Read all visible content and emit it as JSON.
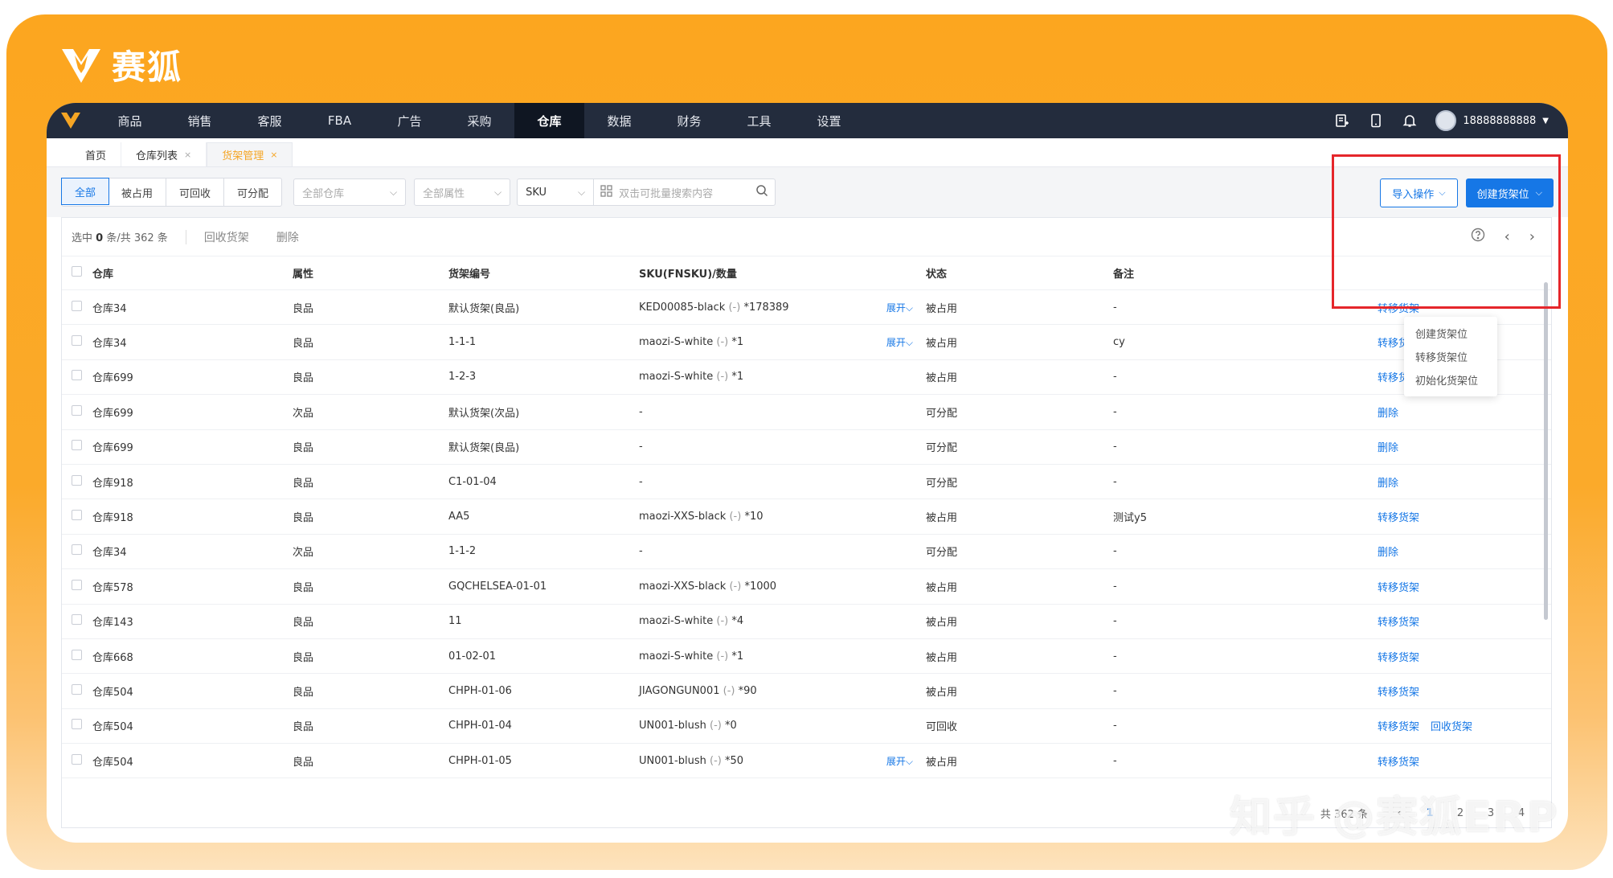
{
  "brand": {
    "name": "赛狐"
  },
  "topnav": {
    "items": [
      "商品",
      "销售",
      "客服",
      "FBA",
      "广告",
      "采购",
      "仓库",
      "数据",
      "财务",
      "工具",
      "设置"
    ],
    "active": "仓库",
    "user": "18888888888"
  },
  "tabs": [
    {
      "label": "首页",
      "closable": false
    },
    {
      "label": "仓库列表",
      "closable": true
    },
    {
      "label": "货架管理",
      "closable": true,
      "active": true
    }
  ],
  "filters": {
    "segments": [
      "全部",
      "被占用",
      "可回收",
      "可分配"
    ],
    "active_segment": "全部",
    "warehouse_placeholder": "全部仓库",
    "attribute_placeholder": "全部属性",
    "search_field": "SKU",
    "search_placeholder": "双击可批量搜索内容",
    "import_button": "导入操作",
    "create_button": "创建货架位"
  },
  "dropdown": {
    "items": [
      "创建货架位",
      "转移货架位",
      "初始化货架位"
    ]
  },
  "toolbar": {
    "count_prefix": "选中",
    "selected": "0",
    "count_suffix": "条/共 362 条",
    "recycle": "回收货架",
    "delete": "删除"
  },
  "table": {
    "headers": [
      "仓库",
      "属性",
      "货架编号",
      "SKU(FNSKU)/数量",
      "状态",
      "备注",
      ""
    ],
    "rows": [
      {
        "warehouse": "仓库34",
        "attr": "良品",
        "shelf": "默认货架(良品)",
        "sku": "KED00085-black",
        "fnsku": "(-)",
        "qty": "*178389",
        "expand": "展开",
        "status": "被占用",
        "remark": "-",
        "ops": [
          "转移货架"
        ]
      },
      {
        "warehouse": "仓库34",
        "attr": "良品",
        "shelf": "1-1-1",
        "sku": "maozi-S-white",
        "fnsku": "(-)",
        "qty": "*1",
        "expand": "展开",
        "status": "被占用",
        "remark": "cy",
        "ops": [
          "转移货架"
        ]
      },
      {
        "warehouse": "仓库699",
        "attr": "良品",
        "shelf": "1-2-3",
        "sku": "maozi-S-white",
        "fnsku": "(-)",
        "qty": "*1",
        "expand": "",
        "status": "被占用",
        "remark": "-",
        "ops": [
          "转移货架"
        ]
      },
      {
        "warehouse": "仓库699",
        "attr": "次品",
        "shelf": "默认货架(次品)",
        "sku": "-",
        "fnsku": "",
        "qty": "",
        "expand": "",
        "status": "可分配",
        "remark": "-",
        "ops": [
          "删除"
        ]
      },
      {
        "warehouse": "仓库699",
        "attr": "良品",
        "shelf": "默认货架(良品)",
        "sku": "-",
        "fnsku": "",
        "qty": "",
        "expand": "",
        "status": "可分配",
        "remark": "-",
        "ops": [
          "删除"
        ]
      },
      {
        "warehouse": "仓库918",
        "attr": "良品",
        "shelf": "C1-01-04",
        "sku": "-",
        "fnsku": "",
        "qty": "",
        "expand": "",
        "status": "可分配",
        "remark": "-",
        "ops": [
          "删除"
        ]
      },
      {
        "warehouse": "仓库918",
        "attr": "良品",
        "shelf": "AA5",
        "sku": "maozi-XXS-black",
        "fnsku": "(-)",
        "qty": "*10",
        "expand": "",
        "status": "被占用",
        "remark": "测试y5",
        "ops": [
          "转移货架"
        ]
      },
      {
        "warehouse": "仓库34",
        "attr": "次品",
        "shelf": "1-1-2",
        "sku": "-",
        "fnsku": "",
        "qty": "",
        "expand": "",
        "status": "可分配",
        "remark": "-",
        "ops": [
          "删除"
        ]
      },
      {
        "warehouse": "仓库578",
        "attr": "良品",
        "shelf": "GQCHELSEA-01-01",
        "sku": "maozi-XXS-black",
        "fnsku": "(-)",
        "qty": "*1000",
        "expand": "",
        "status": "被占用",
        "remark": "-",
        "ops": [
          "转移货架"
        ]
      },
      {
        "warehouse": "仓库143",
        "attr": "良品",
        "shelf": "11",
        "sku": "maozi-S-white",
        "fnsku": "(-)",
        "qty": "*4",
        "expand": "",
        "status": "被占用",
        "remark": "-",
        "ops": [
          "转移货架"
        ]
      },
      {
        "warehouse": "仓库668",
        "attr": "良品",
        "shelf": "01-02-01",
        "sku": "maozi-S-white",
        "fnsku": "(-)",
        "qty": "*1",
        "expand": "",
        "status": "被占用",
        "remark": "-",
        "ops": [
          "转移货架"
        ]
      },
      {
        "warehouse": "仓库504",
        "attr": "良品",
        "shelf": "CHPH-01-06",
        "sku": "JIAGONGUN001",
        "fnsku": "(-)",
        "qty": "*90",
        "expand": "",
        "status": "被占用",
        "remark": "-",
        "ops": [
          "转移货架"
        ]
      },
      {
        "warehouse": "仓库504",
        "attr": "良品",
        "shelf": "CHPH-01-04",
        "sku": "UN001-blush",
        "fnsku": "(-)",
        "qty": "*0",
        "expand": "",
        "status": "可回收",
        "remark": "-",
        "ops": [
          "转移货架",
          "回收货架"
        ]
      },
      {
        "warehouse": "仓库504",
        "attr": "良品",
        "shelf": "CHPH-01-05",
        "sku": "UN001-blush",
        "fnsku": "(-)",
        "qty": "*50",
        "expand": "展开",
        "status": "被占用",
        "remark": "-",
        "ops": [
          "转移货架"
        ]
      }
    ]
  },
  "pagination": {
    "total": "共 362 条",
    "pages": [
      "1",
      "2",
      "3",
      "4"
    ],
    "current": "1"
  },
  "watermark": "知乎 @赛狐ERP",
  "colors": {
    "accent": "#1677e6",
    "brand_orange": "#fca61f",
    "nav_bg": "#232c3d",
    "highlight": "#e5262b"
  }
}
